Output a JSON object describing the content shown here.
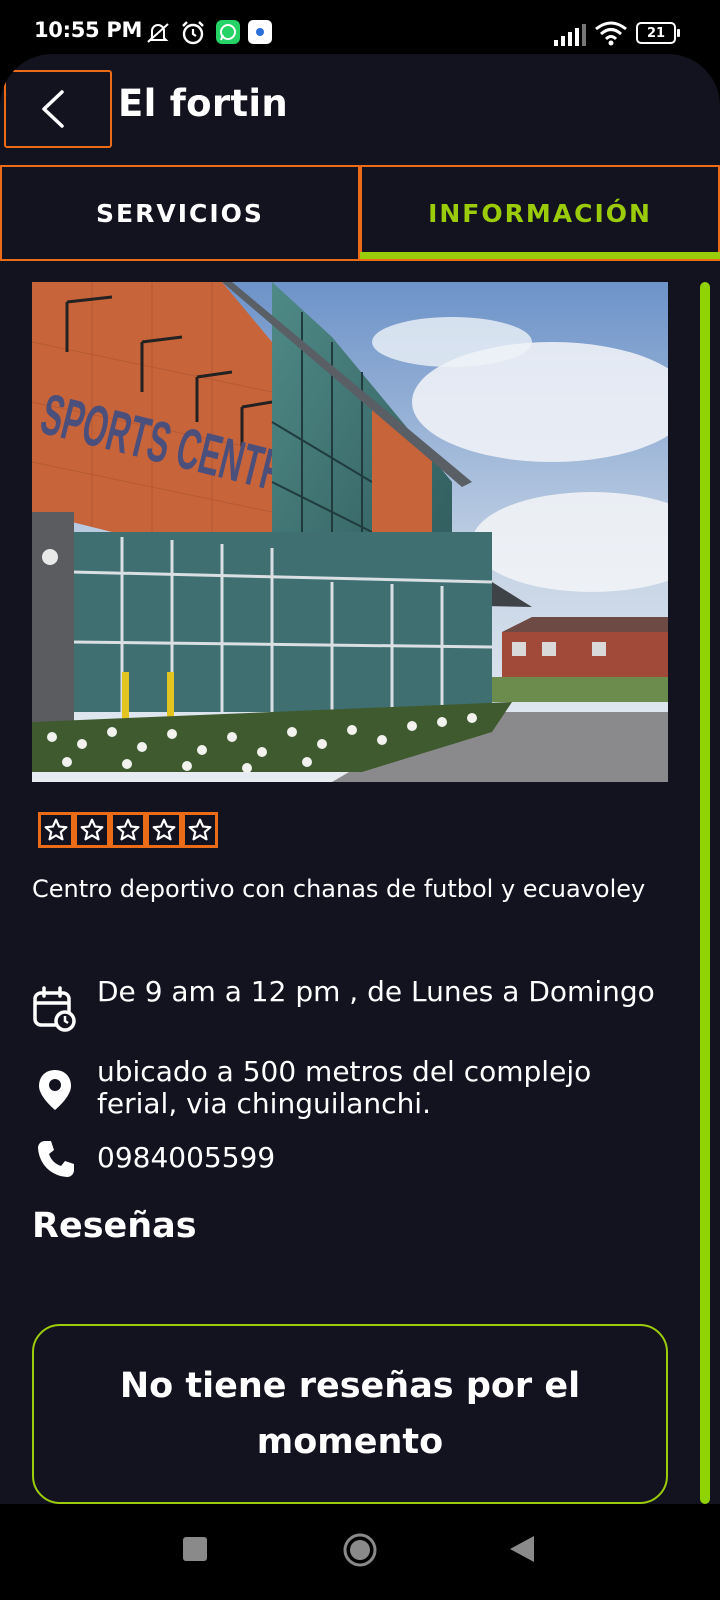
{
  "status_bar": {
    "time": "10:55 PM",
    "battery": "21"
  },
  "header": {
    "title": "El fortin"
  },
  "tabs": [
    {
      "label": "SERVICIOS",
      "active": false
    },
    {
      "label": "INFORMACIÓN",
      "active": true
    }
  ],
  "venue": {
    "hero_sign_text": "SPORTS CENTRE",
    "rating": 0,
    "rating_max": 5,
    "description": "Centro deportivo con chanas de futbol y ecuavoley",
    "schedule": "De 9 am a 12 pm , de Lunes a Domingo",
    "location": "ubicado a 500 metros del complejo ferial, via chinguilanchi.",
    "phone": "0984005599"
  },
  "reviews": {
    "title": "Reseñas",
    "empty_message": "No tiene reseñas por el momento"
  },
  "colors": {
    "background": "#13121f",
    "accent_green": "#9bcc0a",
    "focus_orange": "#ec6b17"
  },
  "icons": [
    "back-arrow-icon",
    "calendar-clock-icon",
    "location-pin-icon",
    "phone-icon",
    "star-outline-icon",
    "nav-recents-icon",
    "nav-home-icon",
    "nav-back-icon"
  ]
}
